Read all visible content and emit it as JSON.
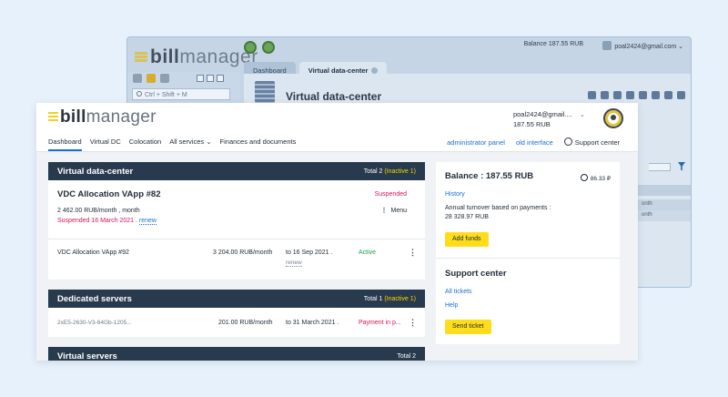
{
  "background_window": {
    "logo_strong": "bill",
    "logo_light": "manager",
    "tabs": [
      "Dashboard",
      "Virtual data-center"
    ],
    "balance": "Balance 187.55 RUB",
    "user": "poal2424@gmail.com",
    "search_placeholder": "Ctrl + Shift + M",
    "page_title": "Virtual data-center",
    "rows": [
      "",
      "onth",
      "onth"
    ]
  },
  "header": {
    "logo_strong": "bill",
    "logo_light": "manager",
    "user_email": "poal2424@gmail....",
    "user_balance": "187.55 RUB",
    "nav": [
      "Dashboard",
      "Virtual DC",
      "Colocation",
      "All services",
      "Finances and documents"
    ],
    "nav_all_services_chevron": "⌄",
    "admin_panel": "administrator panel",
    "old_interface": "old interface",
    "support_center": "Support center"
  },
  "vdc_card": {
    "title": "Virtual data-center",
    "total_label": "Total 2",
    "inactive_label": "(Inactive 1)",
    "item1": {
      "name": "VDC Allocation VApp #82",
      "status": "Suspended",
      "price": "2 462.00 RUB/month , month",
      "menu_label": "Menu",
      "suspended_text": "Suspended 16 March 2021 .",
      "renew": "renew"
    },
    "item2": {
      "name": "VDC Allocation VApp #92",
      "price": "3 204.00 RUB/month",
      "till": "to 16 Sep 2021 .",
      "renew": "renew",
      "status": "Active"
    }
  },
  "dedicated_card": {
    "title": "Dedicated servers",
    "total_label": "Total 1",
    "inactive_label": "(Inactive 1)",
    "row": {
      "id": "2xE5-2630-V3-64Gb-1205...",
      "price": "201.00 RUB/month",
      "till": "to 31 March 2021 .",
      "status": "Payment in p..."
    }
  },
  "vs_card": {
    "title": "Virtual servers",
    "total_label": "Total 2"
  },
  "balance_card": {
    "title": "Balance : 187.55 RUB",
    "small_balance": "86.33 ₽",
    "history": "History",
    "turnover_label": "Annual turnover based on payments :",
    "turnover_value": "28 328.97 RUB",
    "add_funds": "Add funds"
  },
  "support_card": {
    "title": "Support center",
    "all_tickets": "All tickets",
    "help": "Help",
    "send_ticket": "Send ticket"
  },
  "colors": {
    "accent": "#1c6fd6",
    "card_header": "#283a4d",
    "danger": "#d4145a",
    "success": "#1f9e4f",
    "button_yellow": "#ffdd1a",
    "inactive_yellow": "#ffd400"
  }
}
